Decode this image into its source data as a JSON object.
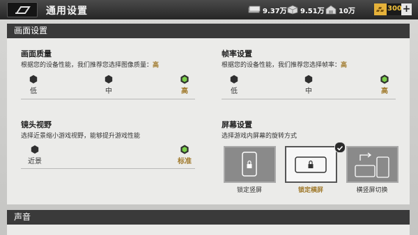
{
  "topbar": {
    "title": "通用设置",
    "resources": [
      {
        "icon": "cash-stack-icon",
        "value": "9.37万"
      },
      {
        "icon": "supply-crate-icon",
        "value": "9.51万"
      },
      {
        "icon": "warehouse-icon",
        "value": "10万"
      }
    ],
    "gold": {
      "icon": "gold-bars-icon",
      "value": "300",
      "plus": "+"
    }
  },
  "graphics": {
    "header": "画面设置",
    "quality": {
      "title": "画面质量",
      "desc_prefix": "根据您的设备性能，我们推荐您选择图像质量：",
      "desc_value": "高",
      "options": [
        {
          "label": "低"
        },
        {
          "label": "中"
        },
        {
          "label": "高"
        }
      ],
      "selected": "高"
    },
    "framerate": {
      "title": "帧率设置",
      "desc_prefix": "根据您的设备性能，我们推荐您选择帧率：",
      "desc_value": "高",
      "options": [
        {
          "label": "低"
        },
        {
          "label": "中"
        },
        {
          "label": "高"
        }
      ],
      "selected": "高"
    },
    "fov": {
      "title": "镜头视野",
      "desc": "选择近景缩小游戏视野，能够提升游戏性能",
      "options": [
        {
          "label": "近景"
        },
        {
          "label": "标准"
        }
      ],
      "selected": "标准"
    },
    "screen": {
      "title": "屏幕设置",
      "desc": "选择游戏内屏幕的旋转方式",
      "modes": [
        {
          "label": "锁定竖屏"
        },
        {
          "label": "锁定横屏"
        },
        {
          "label": "横竖屏切换"
        }
      ],
      "selected": "锁定横屏"
    }
  },
  "sound": {
    "header": "声音"
  },
  "colors": {
    "accent": "#a07a2c",
    "selected_hex": "#7bd04a",
    "unselected_hex": "#2f2f2f"
  }
}
